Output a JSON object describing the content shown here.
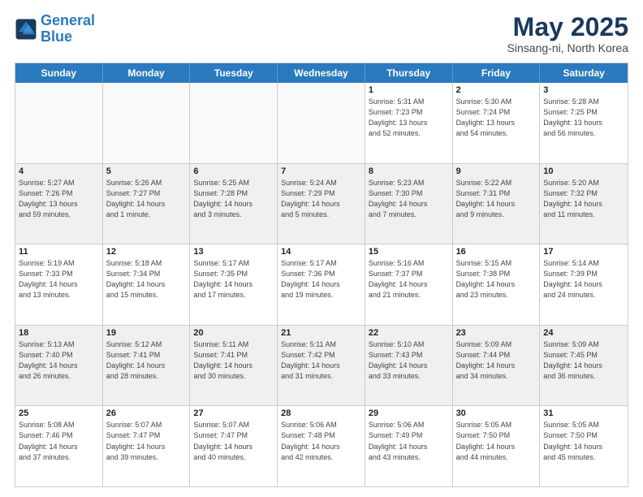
{
  "logo": {
    "line1": "General",
    "line2": "Blue"
  },
  "title": "May 2025",
  "subtitle": "Sinsang-ni, North Korea",
  "days": [
    "Sunday",
    "Monday",
    "Tuesday",
    "Wednesday",
    "Thursday",
    "Friday",
    "Saturday"
  ],
  "weeks": [
    [
      {
        "day": "",
        "info": ""
      },
      {
        "day": "",
        "info": ""
      },
      {
        "day": "",
        "info": ""
      },
      {
        "day": "",
        "info": ""
      },
      {
        "day": "1",
        "info": "Sunrise: 5:31 AM\nSunset: 7:23 PM\nDaylight: 13 hours\nand 52 minutes."
      },
      {
        "day": "2",
        "info": "Sunrise: 5:30 AM\nSunset: 7:24 PM\nDaylight: 13 hours\nand 54 minutes."
      },
      {
        "day": "3",
        "info": "Sunrise: 5:28 AM\nSunset: 7:25 PM\nDaylight: 13 hours\nand 56 minutes."
      }
    ],
    [
      {
        "day": "4",
        "info": "Sunrise: 5:27 AM\nSunset: 7:26 PM\nDaylight: 13 hours\nand 59 minutes."
      },
      {
        "day": "5",
        "info": "Sunrise: 5:26 AM\nSunset: 7:27 PM\nDaylight: 14 hours\nand 1 minute."
      },
      {
        "day": "6",
        "info": "Sunrise: 5:25 AM\nSunset: 7:28 PM\nDaylight: 14 hours\nand 3 minutes."
      },
      {
        "day": "7",
        "info": "Sunrise: 5:24 AM\nSunset: 7:29 PM\nDaylight: 14 hours\nand 5 minutes."
      },
      {
        "day": "8",
        "info": "Sunrise: 5:23 AM\nSunset: 7:30 PM\nDaylight: 14 hours\nand 7 minutes."
      },
      {
        "day": "9",
        "info": "Sunrise: 5:22 AM\nSunset: 7:31 PM\nDaylight: 14 hours\nand 9 minutes."
      },
      {
        "day": "10",
        "info": "Sunrise: 5:20 AM\nSunset: 7:32 PM\nDaylight: 14 hours\nand 11 minutes."
      }
    ],
    [
      {
        "day": "11",
        "info": "Sunrise: 5:19 AM\nSunset: 7:33 PM\nDaylight: 14 hours\nand 13 minutes."
      },
      {
        "day": "12",
        "info": "Sunrise: 5:18 AM\nSunset: 7:34 PM\nDaylight: 14 hours\nand 15 minutes."
      },
      {
        "day": "13",
        "info": "Sunrise: 5:17 AM\nSunset: 7:35 PM\nDaylight: 14 hours\nand 17 minutes."
      },
      {
        "day": "14",
        "info": "Sunrise: 5:17 AM\nSunset: 7:36 PM\nDaylight: 14 hours\nand 19 minutes."
      },
      {
        "day": "15",
        "info": "Sunrise: 5:16 AM\nSunset: 7:37 PM\nDaylight: 14 hours\nand 21 minutes."
      },
      {
        "day": "16",
        "info": "Sunrise: 5:15 AM\nSunset: 7:38 PM\nDaylight: 14 hours\nand 23 minutes."
      },
      {
        "day": "17",
        "info": "Sunrise: 5:14 AM\nSunset: 7:39 PM\nDaylight: 14 hours\nand 24 minutes."
      }
    ],
    [
      {
        "day": "18",
        "info": "Sunrise: 5:13 AM\nSunset: 7:40 PM\nDaylight: 14 hours\nand 26 minutes."
      },
      {
        "day": "19",
        "info": "Sunrise: 5:12 AM\nSunset: 7:41 PM\nDaylight: 14 hours\nand 28 minutes."
      },
      {
        "day": "20",
        "info": "Sunrise: 5:11 AM\nSunset: 7:41 PM\nDaylight: 14 hours\nand 30 minutes."
      },
      {
        "day": "21",
        "info": "Sunrise: 5:11 AM\nSunset: 7:42 PM\nDaylight: 14 hours\nand 31 minutes."
      },
      {
        "day": "22",
        "info": "Sunrise: 5:10 AM\nSunset: 7:43 PM\nDaylight: 14 hours\nand 33 minutes."
      },
      {
        "day": "23",
        "info": "Sunrise: 5:09 AM\nSunset: 7:44 PM\nDaylight: 14 hours\nand 34 minutes."
      },
      {
        "day": "24",
        "info": "Sunrise: 5:09 AM\nSunset: 7:45 PM\nDaylight: 14 hours\nand 36 minutes."
      }
    ],
    [
      {
        "day": "25",
        "info": "Sunrise: 5:08 AM\nSunset: 7:46 PM\nDaylight: 14 hours\nand 37 minutes."
      },
      {
        "day": "26",
        "info": "Sunrise: 5:07 AM\nSunset: 7:47 PM\nDaylight: 14 hours\nand 39 minutes."
      },
      {
        "day": "27",
        "info": "Sunrise: 5:07 AM\nSunset: 7:47 PM\nDaylight: 14 hours\nand 40 minutes."
      },
      {
        "day": "28",
        "info": "Sunrise: 5:06 AM\nSunset: 7:48 PM\nDaylight: 14 hours\nand 42 minutes."
      },
      {
        "day": "29",
        "info": "Sunrise: 5:06 AM\nSunset: 7:49 PM\nDaylight: 14 hours\nand 43 minutes."
      },
      {
        "day": "30",
        "info": "Sunrise: 5:05 AM\nSunset: 7:50 PM\nDaylight: 14 hours\nand 44 minutes."
      },
      {
        "day": "31",
        "info": "Sunrise: 5:05 AM\nSunset: 7:50 PM\nDaylight: 14 hours\nand 45 minutes."
      }
    ]
  ]
}
